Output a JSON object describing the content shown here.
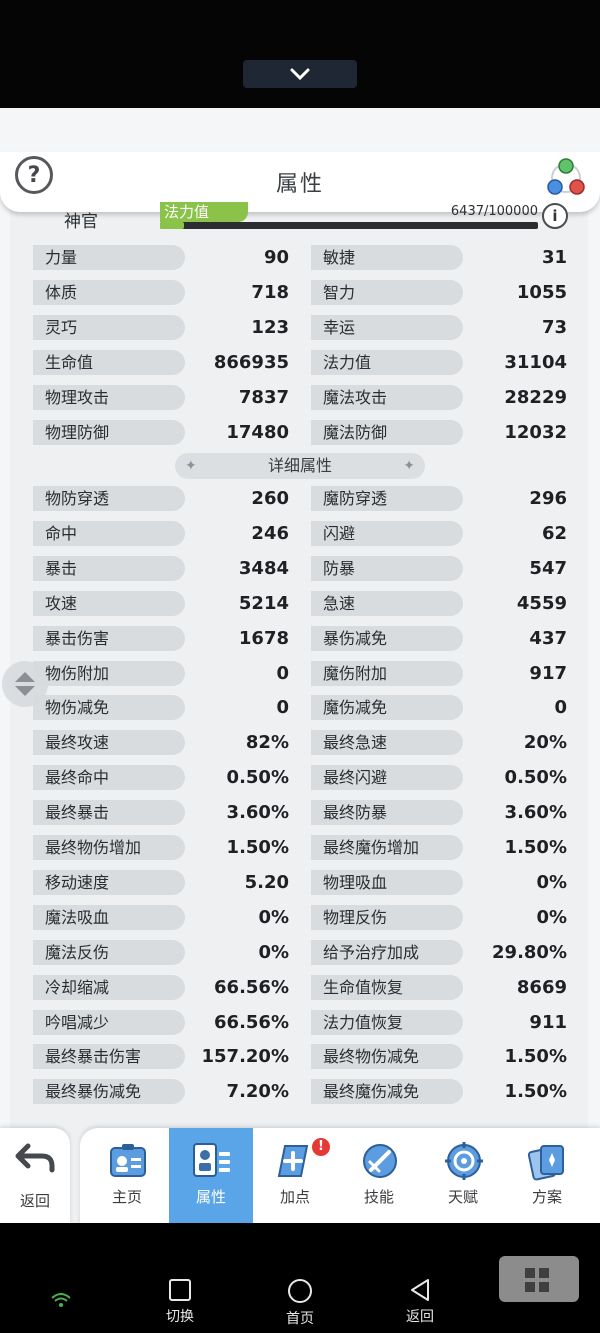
{
  "header": {
    "title": "属性",
    "help_label": "?"
  },
  "character": {
    "class_name": "神官",
    "mp_label": "法力值",
    "mp_value": "6437/100000",
    "mp_fraction": 0.064,
    "info_label": "i"
  },
  "basic_stats": [
    {
      "left_label": "力量",
      "left_value": "90",
      "right_label": "敏捷",
      "right_value": "31"
    },
    {
      "left_label": "体质",
      "left_value": "718",
      "right_label": "智力",
      "right_value": "1055"
    },
    {
      "left_label": "灵巧",
      "left_value": "123",
      "right_label": "幸运",
      "right_value": "73"
    },
    {
      "left_label": "生命值",
      "left_value": "866935",
      "right_label": "法力值",
      "right_value": "31104"
    },
    {
      "left_label": "物理攻击",
      "left_value": "7837",
      "right_label": "魔法攻击",
      "right_value": "28229"
    },
    {
      "left_label": "物理防御",
      "left_value": "17480",
      "right_label": "魔法防御",
      "right_value": "12032"
    }
  ],
  "detail_section_title": "详细属性",
  "detail_stats": [
    {
      "left_label": "物防穿透",
      "left_value": "260",
      "right_label": "魔防穿透",
      "right_value": "296"
    },
    {
      "left_label": "命中",
      "left_value": "246",
      "right_label": "闪避",
      "right_value": "62"
    },
    {
      "left_label": "暴击",
      "left_value": "3484",
      "right_label": "防暴",
      "right_value": "547"
    },
    {
      "left_label": "攻速",
      "left_value": "5214",
      "right_label": "急速",
      "right_value": "4559"
    },
    {
      "left_label": "暴击伤害",
      "left_value": "1678",
      "right_label": "暴伤减免",
      "right_value": "437"
    },
    {
      "left_label": "物伤附加",
      "left_value": "0",
      "right_label": "魔伤附加",
      "right_value": "917"
    },
    {
      "left_label": "物伤减免",
      "left_value": "0",
      "right_label": "魔伤减免",
      "right_value": "0"
    },
    {
      "left_label": "最终攻速",
      "left_value": "82%",
      "right_label": "最终急速",
      "right_value": "20%"
    },
    {
      "left_label": "最终命中",
      "left_value": "0.50%",
      "right_label": "最终闪避",
      "right_value": "0.50%"
    },
    {
      "left_label": "最终暴击",
      "left_value": "3.60%",
      "right_label": "最终防暴",
      "right_value": "3.60%"
    },
    {
      "left_label": "最终物伤增加",
      "left_value": "1.50%",
      "right_label": "最终魔伤增加",
      "right_value": "1.50%"
    },
    {
      "left_label": "移动速度",
      "left_value": "5.20",
      "right_label": "物理吸血",
      "right_value": "0%"
    },
    {
      "left_label": "魔法吸血",
      "left_value": "0%",
      "right_label": "物理反伤",
      "right_value": "0%"
    },
    {
      "left_label": "魔法反伤",
      "left_value": "0%",
      "right_label": "给予治疗加成",
      "right_value": "29.80%"
    },
    {
      "left_label": "冷却缩减",
      "left_value": "66.56%",
      "right_label": "生命值恢复",
      "right_value": "8669"
    },
    {
      "left_label": "吟唱减少",
      "left_value": "66.56%",
      "right_label": "法力值恢复",
      "right_value": "911"
    },
    {
      "left_label": "最终暴击伤害",
      "left_value": "157.20%",
      "right_label": "最终物伤减免",
      "right_value": "1.50%"
    },
    {
      "left_label": "最终暴伤减免",
      "left_value": "7.20%",
      "right_label": "最终魔伤减免",
      "right_value": "1.50%"
    }
  ],
  "bottom_nav": {
    "back_label": "返回",
    "tabs": [
      {
        "label": "主页",
        "icon": "id-card-icon"
      },
      {
        "label": "属性",
        "icon": "attributes-icon",
        "active": true
      },
      {
        "label": "加点",
        "icon": "add-point-icon",
        "badge": "!"
      },
      {
        "label": "技能",
        "icon": "skill-sword-icon"
      },
      {
        "label": "天赋",
        "icon": "talent-icon"
      },
      {
        "label": "方案",
        "icon": "cards-icon"
      }
    ]
  },
  "system_nav": {
    "switch_label": "切换",
    "home_label": "首页",
    "back_label": "返回"
  },
  "colors": {
    "active_tab": "#5aa4e8",
    "mp_bar": "#8bc34a",
    "badge": "#e53935"
  }
}
